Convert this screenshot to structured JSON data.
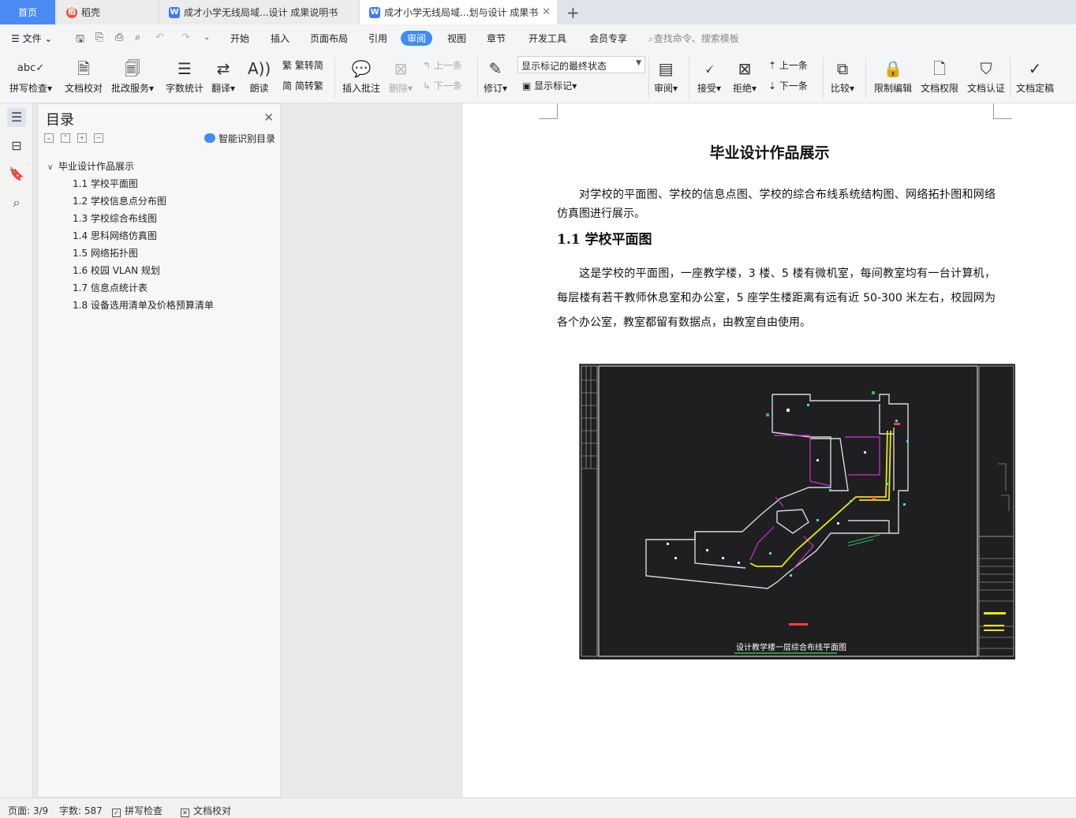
{
  "tabs": {
    "home": "首页",
    "daoke": "稻壳",
    "doc1": "成才小学无线局域...设计 成果说明书",
    "doc2": "成才小学无线局域...划与设计 成果书"
  },
  "menu": {
    "file": "文件",
    "items": [
      "开始",
      "插入",
      "页面布局",
      "引用",
      "审阅",
      "视图",
      "章节",
      "开发工具",
      "会员专享"
    ],
    "search": "查找命令、搜索模板"
  },
  "ribbon": {
    "spell": "拼写检查",
    "proof": "文档校对",
    "revise_service": "批改服务",
    "word_count": "字数统计",
    "translate": "翻译",
    "read": "朗读",
    "to_trad": "繁转简",
    "to_simp": "简转繁",
    "insert_comment": "插入批注",
    "delete": "删除",
    "prev": "上一条",
    "next": "下一条",
    "track": "修订",
    "markup_state": "显示标记的最终状态",
    "show_markup": "显示标记",
    "review": "审阅",
    "accept": "接受",
    "reject": "拒绝",
    "prev2": "上一条",
    "next2": "下一条",
    "compare": "比较",
    "restrict": "限制编辑",
    "permission": "文档权限",
    "certify": "文档认证",
    "finalize": "文档定稿"
  },
  "toc": {
    "title": "目录",
    "smart": "智能识别目录",
    "items": [
      {
        "text": "毕业设计作品展示"
      },
      {
        "text": "1.1  学校平面图"
      },
      {
        "text": "1.2  学校信息点分布图"
      },
      {
        "text": "1.3  学校综合布线图"
      },
      {
        "text": "1.4  思科网络仿真图"
      },
      {
        "text": "1.5  网络拓扑图"
      },
      {
        "text": "1.6  校园 VLAN 规划"
      },
      {
        "text": "1.7  信息点统计表"
      },
      {
        "text": "1.8  设备选用清单及价格预算清单"
      }
    ]
  },
  "doc": {
    "title": "毕业设计作品展示",
    "intro": "对学校的平面图、学校的信息点图、学校的综合布线系统结构图、网络拓扑图和网络仿真图进行展示。",
    "h2": "1.1  学校平面图",
    "para": "这是学校的平面图，一座教学楼，3 楼、5 楼有微机室，每间教室均有一台计算机，每层楼有若干教师休息室和办公室，5 座学生楼距离有远有近 50-300 米左右，校园网为各个办公室，教室都留有数据点，由教室自由使用。",
    "figure_caption": "设计教学楼一层综合布线平面图"
  },
  "status": {
    "page": "页面: 3/9",
    "words": "字数: 587",
    "spell": "拼写检查",
    "proof": "文档校对"
  },
  "colors": {
    "accent": "#3f8cf6",
    "cad_bg": "#1f1f22",
    "cad_wall": "#d8d8d8",
    "cad_cable": "#f0e800",
    "cad_magenta": "#cc33cc"
  }
}
